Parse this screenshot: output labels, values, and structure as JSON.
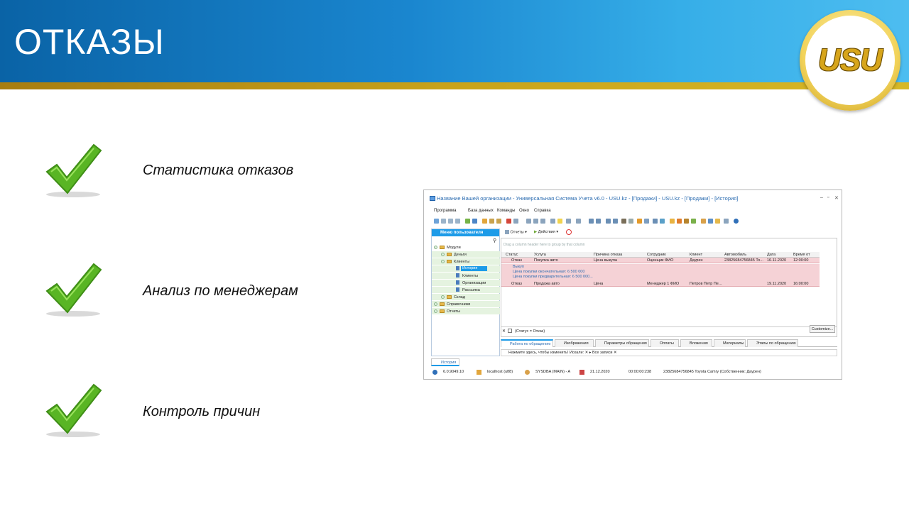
{
  "slide": {
    "title": "ОТКАЗЫ",
    "logo_text": "USU",
    "bullets": [
      {
        "text": "Статистика отказов"
      },
      {
        "text": "Анализ по менеджерам"
      },
      {
        "text": "Контроль причин"
      }
    ]
  },
  "colors": {
    "header_blue": "#1a86cf",
    "gold_stripe": "#c9a31a",
    "check_green": "#59b524",
    "app_accent": "#1d9be8",
    "row_highlight": "#f5d2d6"
  },
  "app": {
    "window_title": "Название Вашей организации - Универсальная Система Учета v6.0 - USU.kz - [Продажи] - USU.kz - [Продажи] - [История]",
    "menu": [
      "Программа",
      "База данных",
      "Команды",
      "Окно",
      "Справка"
    ],
    "sidebar": {
      "header": "Меню пользователя",
      "tree": [
        {
          "label": "Модули"
        },
        {
          "label": "Деньги"
        },
        {
          "label": "Клиенты"
        },
        {
          "label": "История"
        },
        {
          "label": "Клиенты"
        },
        {
          "label": "Организации"
        },
        {
          "label": "Рассылка"
        },
        {
          "label": "Склад"
        },
        {
          "label": "Справочники"
        },
        {
          "label": "Отчеты"
        }
      ]
    },
    "subtoolbar": {
      "reports": "Отчеты",
      "actions": "Действия"
    },
    "grid": {
      "group_hint": "Drag a column header here to group by that column",
      "columns": [
        "Статус",
        "Услуга",
        "Причина отказа",
        "Сотрудник",
        "Клиент",
        "Автомобиль",
        "Дата",
        "Время от"
      ],
      "rows": [
        [
          "Отказ",
          "Покупка авто",
          "Цена выкупа",
          "Оценщик ФИО",
          "Даурен",
          "23825684756845 То...",
          "16.11.2020",
          "12:00:00"
        ],
        [
          "Отказ",
          "Продажа авто",
          "Цена",
          "Менеджер 1 ФИО",
          "Петров Петр Пе...",
          "",
          "19.11.2020",
          "16:00:00"
        ]
      ],
      "detail": [
        "Выкуп",
        "Цена покупки окончательная: 6 500 000",
        "Цена покупки предварительная: 6 500 000..."
      ]
    },
    "filter": {
      "text": "(Статус = Отказ)",
      "customize": "Customize..."
    },
    "tabs": [
      "Работа по обращению",
      "Изображения",
      "Параметры обращения",
      "Оплаты",
      "Вложения",
      "Материалы",
      "Этапы по обращению"
    ],
    "search_hint": "Нажмите здесь, чтобы изменить! Искали:",
    "search_all": "Все записи",
    "bottom_tab": "История",
    "status": {
      "version": "6.0.9049.10",
      "server": "localhost (utf8)",
      "user": "SYSDBA (MAIN) - A",
      "date": "21.12.2020",
      "timer": "00:00:00:238",
      "record": "23825684756845 Toyota Camry (Собственник: Даурен)"
    }
  }
}
